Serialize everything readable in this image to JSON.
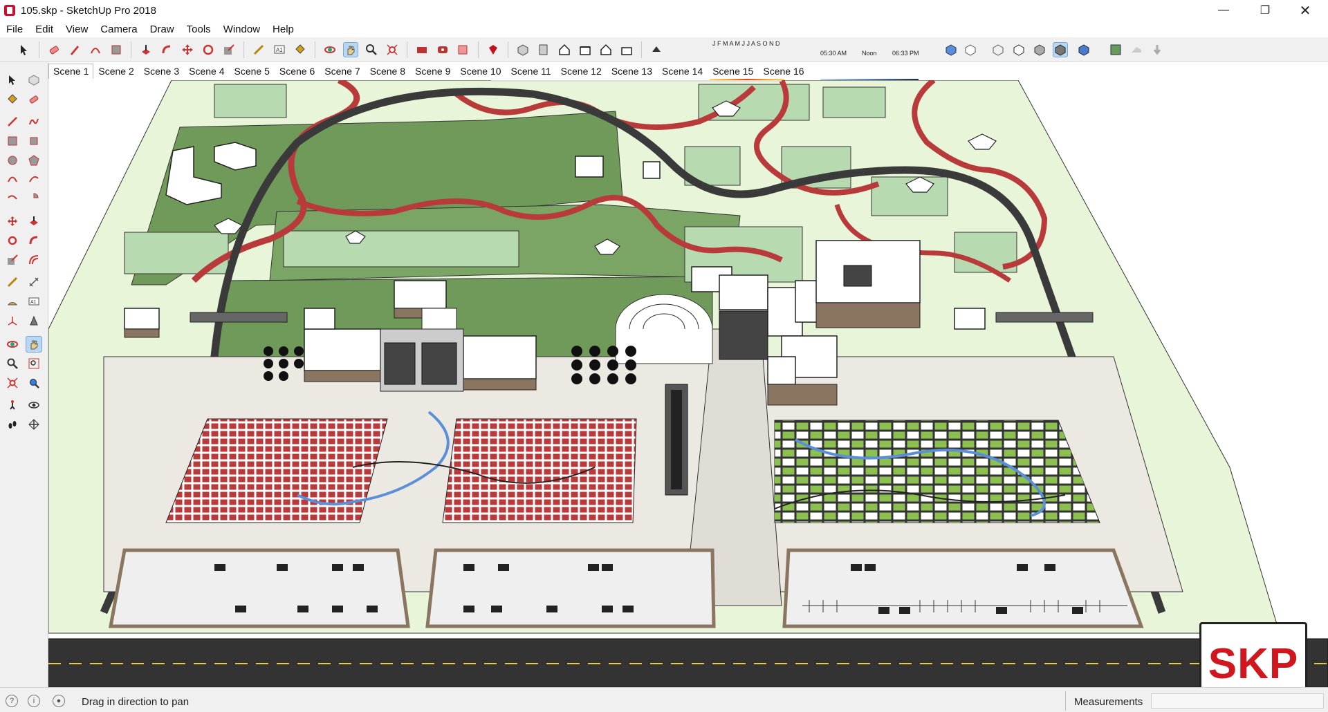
{
  "window": {
    "title": "105.skp - SketchUp Pro 2018"
  },
  "menu": [
    "File",
    "Edit",
    "View",
    "Camera",
    "Draw",
    "Tools",
    "Window",
    "Help"
  ],
  "shadow_widget": {
    "months": "J F M A M J J A S O N D",
    "time_start": "05:30 AM",
    "time_mid": "Noon",
    "time_end": "06:33 PM"
  },
  "scenes": [
    "Scene 1",
    "Scene 2",
    "Scene 3",
    "Scene 4",
    "Scene 5",
    "Scene 6",
    "Scene 7",
    "Scene 8",
    "Scene 9",
    "Scene 10",
    "Scene 11",
    "Scene 12",
    "Scene 13",
    "Scene 14",
    "Scene 15",
    "Scene 16"
  ],
  "active_scene": "Scene 1",
  "status": {
    "hint": "Drag in direction to pan",
    "measurements_label": "Measurements"
  },
  "watermark": "SKP",
  "colors": {
    "grass_light": "#e8f5d8",
    "grass_dark": "#6f9a5a",
    "path_red": "#b83a3a",
    "road": "#3a3a3a",
    "plaza": "#ece8e2",
    "accent_blue": "#b9d6f2"
  },
  "toolbar_icons": [
    "select-icon",
    "eraser-icon",
    "pencil-icon",
    "arc-icon",
    "rectangle-icon",
    "push-pull-icon",
    "follow-me-icon",
    "move-icon",
    "rotate-icon",
    "scale-icon",
    "tape-measure-icon",
    "text-icon",
    "paint-bucket-icon",
    "orbit-icon",
    "pan-icon",
    "zoom-icon",
    "zoom-extents-icon",
    "warehouse-icon",
    "extension-warehouse-icon",
    "layout-icon",
    "ruby-icon",
    "iso-view-icon",
    "top-view-icon",
    "front-view-icon",
    "right-view-icon",
    "back-view-icon",
    "left-view-icon",
    "shadows-icon",
    "xray-icon",
    "back-edges-icon",
    "wireframe-icon",
    "hidden-line-icon",
    "shaded-icon",
    "shaded-texture-icon",
    "monochrome-icon",
    "geo-location-icon",
    "sandbox-icon",
    "add-location-icon"
  ]
}
